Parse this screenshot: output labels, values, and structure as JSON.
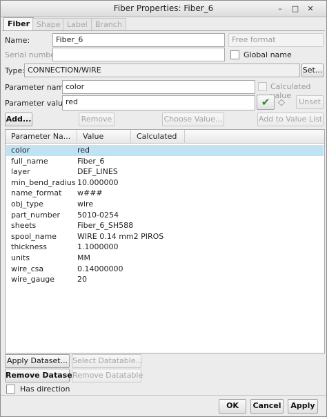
{
  "window": {
    "title": "Fiber Properties: Fiber_6",
    "minimize_glyph": "–",
    "maximize_glyph": "□",
    "close_glyph": "✕"
  },
  "tabs": [
    {
      "label": "Fiber",
      "active": true
    },
    {
      "label": "Shape",
      "active": false
    },
    {
      "label": "Label",
      "active": false
    },
    {
      "label": "Branch",
      "active": false
    }
  ],
  "form": {
    "name_label": "Name:",
    "name_value": "Fiber_6",
    "format_value": "Free format",
    "serial_label": "Serial number:",
    "serial_value": "",
    "global_name_label": "Global name",
    "type_label": "Type:",
    "type_value": "CONNECTION/WIRE",
    "set_button": "Set...",
    "param_name_label": "Parameter name:",
    "param_name_value": "color",
    "calculated_value_label": "Calculated value",
    "param_value_label": "Parameter value:",
    "param_value_value": "red",
    "unset_button": "Unset"
  },
  "actions": {
    "add": "Add...",
    "remove": "Remove",
    "choose_value": "Choose Value...",
    "add_to_value_list": "Add to Value List"
  },
  "table": {
    "columns": [
      "Parameter Na...",
      "Value",
      "Calculated"
    ],
    "rows": [
      {
        "name": "color",
        "value": "red",
        "selected": true
      },
      {
        "name": "full_name",
        "value": "Fiber_6"
      },
      {
        "name": "layer",
        "value": "DEF_LINES"
      },
      {
        "name": "min_bend_radius",
        "value": "10.000000"
      },
      {
        "name": "name_format",
        "value": "w###"
      },
      {
        "name": "obj_type",
        "value": "wire"
      },
      {
        "name": "part_number",
        "value": "5010-0254"
      },
      {
        "name": "sheets",
        "value": "Fiber_6_SH588"
      },
      {
        "name": "spool_name",
        "value": "WIRE 0.14 mm2 PIROS"
      },
      {
        "name": "thickness",
        "value": "1.1000000"
      },
      {
        "name": "units",
        "value": "MM"
      },
      {
        "name": "wire_csa",
        "value": "0.14000000"
      },
      {
        "name": "wire_gauge",
        "value": "20"
      }
    ]
  },
  "dataset": {
    "apply": "Apply Dataset...",
    "select_datatable": "Select Datatable...",
    "remove": "Remove Dataset",
    "remove_datatable": "Remove Datatable",
    "has_direction": "Has direction"
  },
  "footer": {
    "ok": "OK",
    "cancel": "Cancel",
    "apply": "Apply"
  },
  "icons": {
    "accept": "✔",
    "eraser": "◇"
  },
  "colors": {
    "selection": "#bfe3f5",
    "accept_green": "#2a8a2a"
  }
}
